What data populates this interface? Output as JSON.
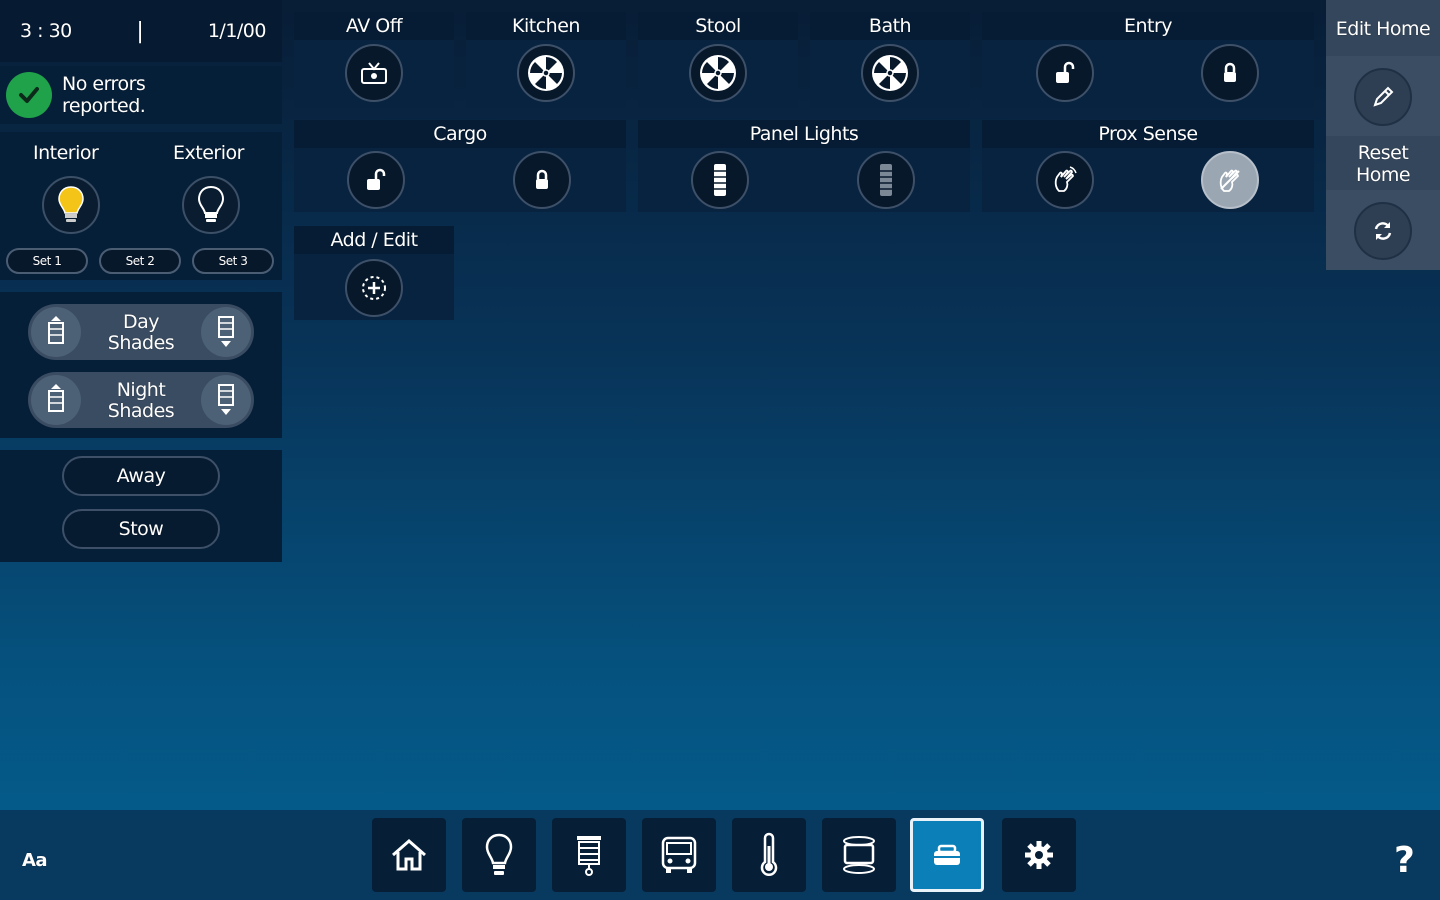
{
  "status": {
    "time": "3 : 30",
    "separator": "|",
    "date": "1/1/00"
  },
  "errors": {
    "line1": "No errors",
    "line2": "reported."
  },
  "lights": {
    "interior_label": "Interior",
    "exterior_label": "Exterior",
    "sets": [
      "Set 1",
      "Set 2",
      "Set 3"
    ]
  },
  "shades": {
    "day": {
      "line1": "Day",
      "line2": "Shades"
    },
    "night": {
      "line1": "Night",
      "line2": "Shades"
    }
  },
  "modes": {
    "away": "Away",
    "stow": "Stow"
  },
  "tiles": {
    "av_off": "AV Off",
    "kitchen": "Kitchen",
    "stool": "Stool",
    "bath": "Bath",
    "entry": "Entry",
    "cargo": "Cargo",
    "panel_lights": "Panel Lights",
    "prox_sense": "Prox Sense",
    "add_edit": "Add / Edit"
  },
  "right_panel": {
    "edit_home": "Edit Home",
    "reset_line1": "Reset",
    "reset_line2": "Home"
  },
  "bottom": {
    "font_size": "Aa",
    "help": "?",
    "nav": [
      "home",
      "lighting",
      "shades",
      "vehicle",
      "climate",
      "media",
      "plumbing",
      "settings"
    ],
    "active_nav": "plumbing"
  },
  "colors": {
    "accent": "#0a7fb8",
    "ok_green": "#1fa24a",
    "bulb_on": "#f4c518"
  }
}
